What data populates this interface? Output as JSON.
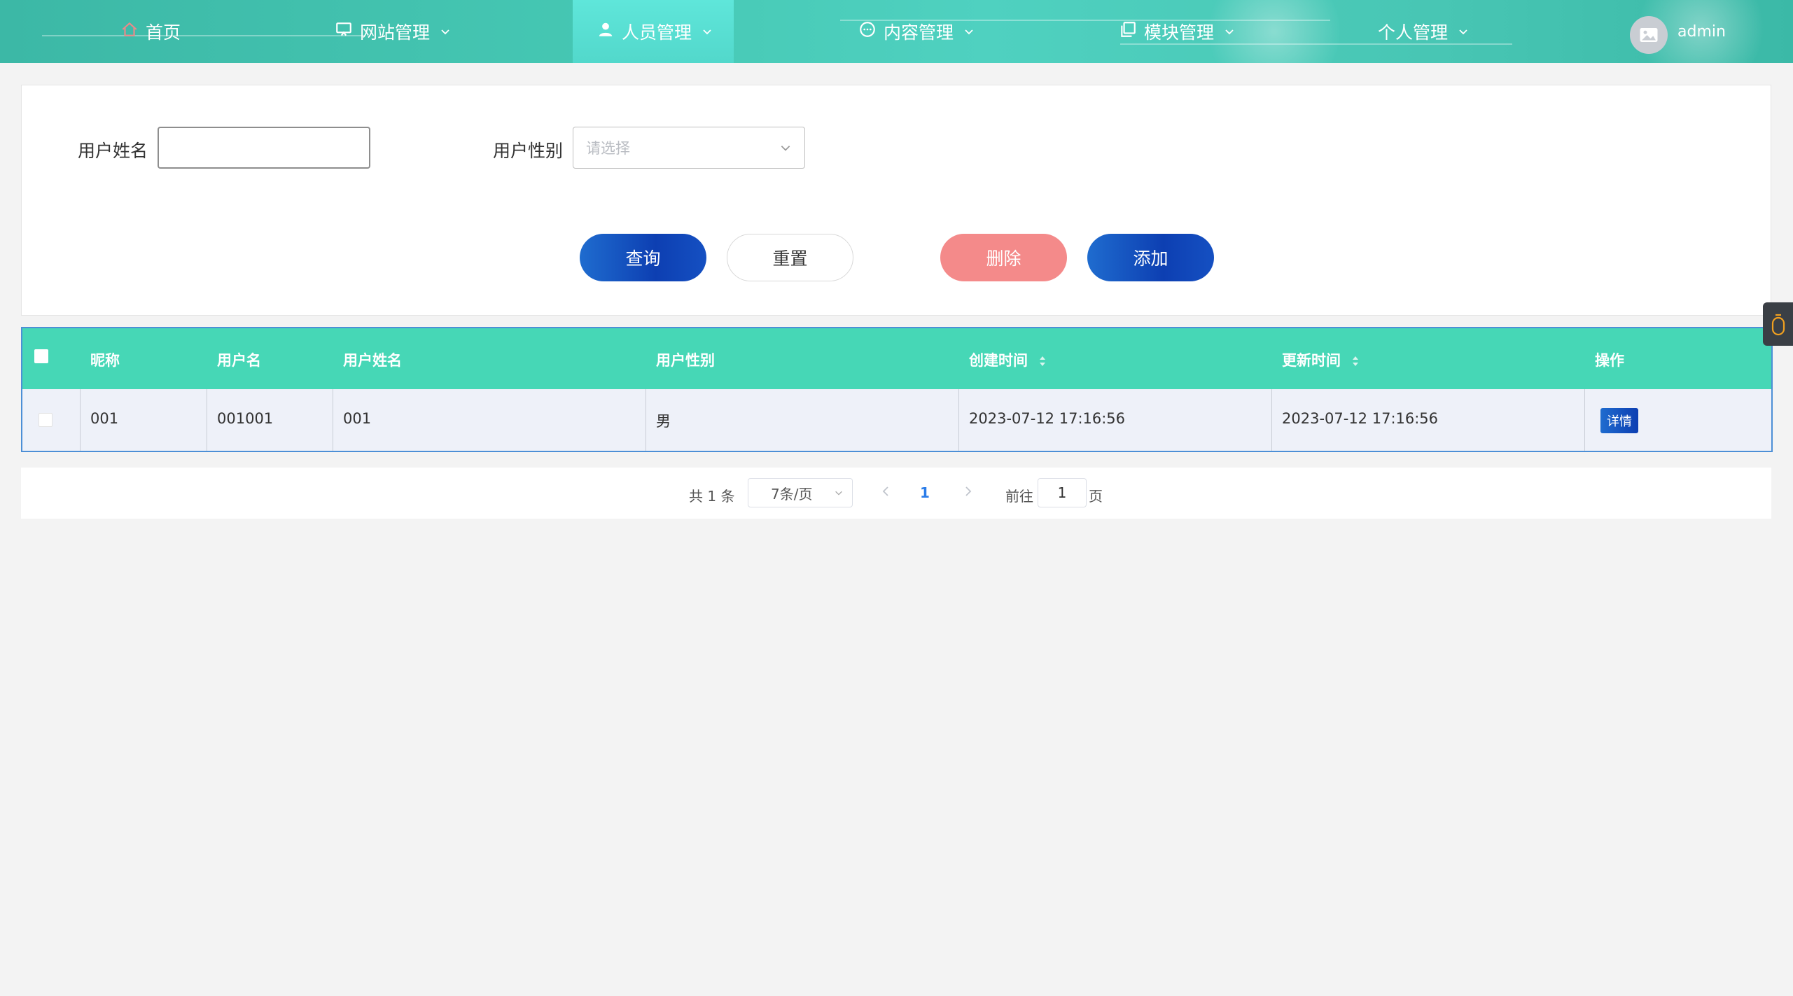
{
  "nav": {
    "items": [
      {
        "label": "首页",
        "icon": "home-icon"
      },
      {
        "label": "网站管理",
        "icon": "monitor-icon"
      },
      {
        "label": "人员管理",
        "icon": "user-icon",
        "active": true
      },
      {
        "label": "内容管理",
        "icon": "chat-icon"
      },
      {
        "label": "模块管理",
        "icon": "copy-icon"
      },
      {
        "label": "个人管理",
        "icon": ""
      }
    ],
    "user": "admin"
  },
  "search": {
    "name_label": "用户姓名",
    "name_value": "",
    "gender_label": "用户性别",
    "gender_placeholder": "请选择",
    "query": "查询",
    "reset": "重置",
    "delete": "删除",
    "add": "添加"
  },
  "table": {
    "headers": [
      "昵称",
      "用户名",
      "用户姓名",
      "用户性别",
      "创建时间",
      "更新时间",
      "操作"
    ],
    "rows": [
      {
        "nickname": "001",
        "username": "001001",
        "realname": "001",
        "gender": "男",
        "created": "2023-07-12 17:16:56",
        "updated": "2023-07-12 17:16:56",
        "action": "详情"
      }
    ]
  },
  "pagination": {
    "total": "共 1 条",
    "page_size": "7条/页",
    "current": "1",
    "goto_label": "前往",
    "goto_value": "1",
    "page_suffix": "页"
  },
  "colors": {
    "header_teal": "#46d7b6",
    "nav_teal": "#4fd1c0",
    "primary_blue": "#0d3fb2",
    "danger_pink": "#f48a8a",
    "page_link": "#2b7de9"
  }
}
